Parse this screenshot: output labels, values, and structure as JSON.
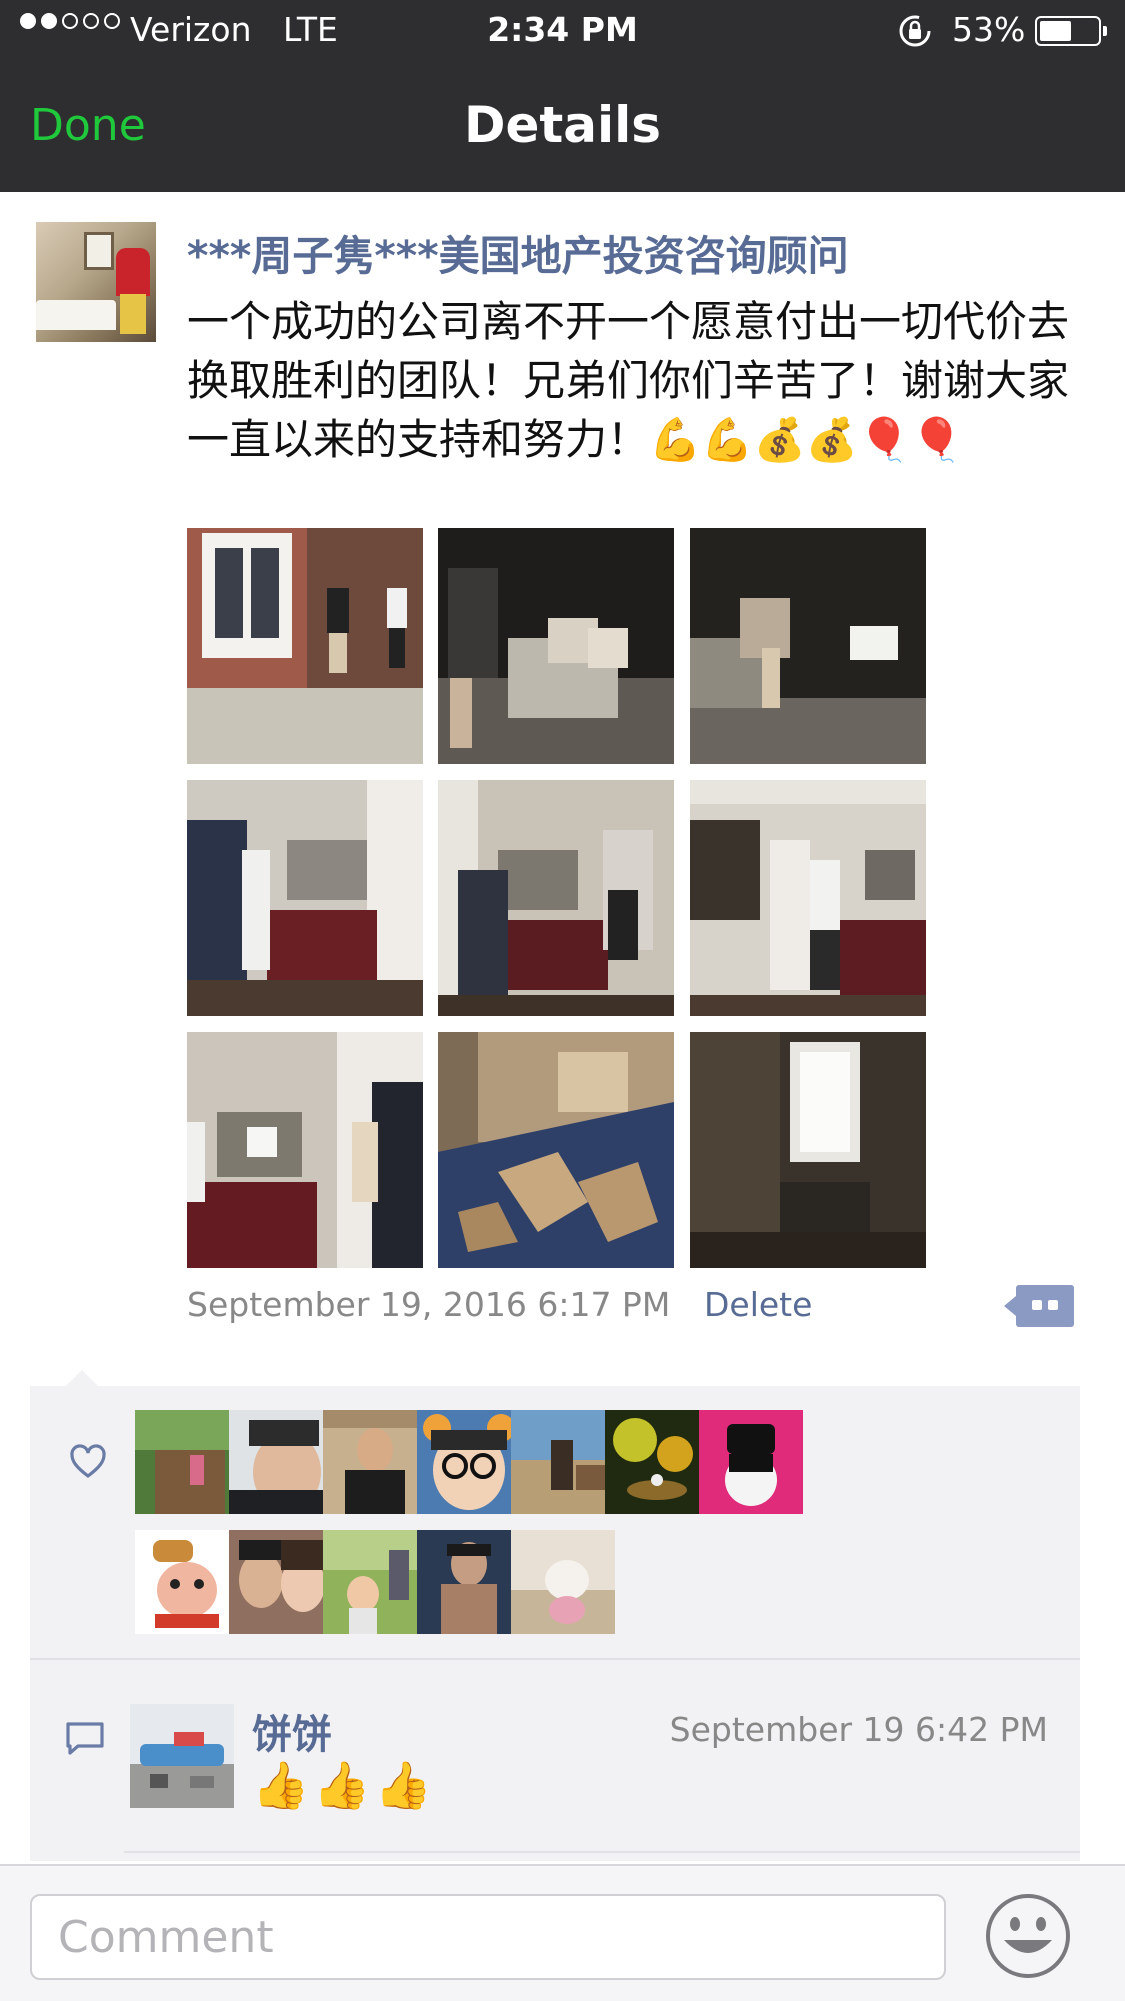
{
  "status_bar": {
    "carrier": "Verizon",
    "network": "LTE",
    "time": "2:34 PM",
    "battery_percent": "53%",
    "battery_level": 0.53,
    "signal_bars_filled": 2,
    "signal_bars_total": 5
  },
  "nav": {
    "done_label": "Done",
    "title": "Details"
  },
  "post": {
    "author": "***周子隽***美国地产投资咨询顾问",
    "text": "一个成功的公司离不开一个愿意付出一切代价去换取胜利的团队！兄弟们你们辛苦了！谢谢大家一直以来的支持和努力！💪💪💰💰🎈🎈",
    "timestamp": "September 19, 2016 6:17 PM",
    "delete_label": "Delete",
    "photo_count": 9
  },
  "likes": {
    "count": 12
  },
  "comments": [
    {
      "name": "饼饼",
      "time": "September 19 6:42 PM",
      "text": "👍👍👍"
    }
  ],
  "comment_box": {
    "placeholder": "Comment"
  },
  "colors": {
    "bar_background": "#2e2e30",
    "done_green": "#1fc93b",
    "link_blue": "#576b95",
    "timestamp_gray": "#888888"
  },
  "icons": [
    "lock-rotation-icon",
    "battery-icon",
    "heart-icon",
    "comment-bubble-icon",
    "more-options-icon",
    "emoji-icon"
  ]
}
